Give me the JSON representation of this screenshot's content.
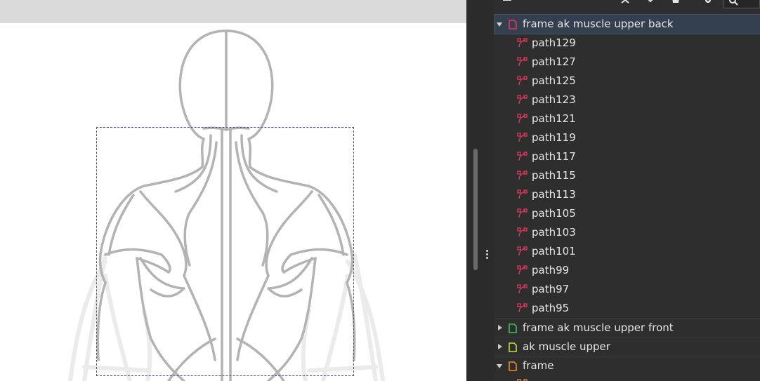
{
  "canvas": {
    "background": "#ffffff",
    "figure": "human upper back muscle diagram"
  },
  "panel": {
    "toolbar_icons": [
      "layers-icon",
      "close-icon",
      "chevron-down-icon",
      "trash-icon",
      "gear-icon",
      "search-icon"
    ],
    "tree": [
      {
        "label": "frame ak muscle upper back",
        "kind": "group",
        "expanded": true,
        "selected": true,
        "icon_color": "#e8355f",
        "icon": "group-icon"
      },
      {
        "label": "path129",
        "kind": "path",
        "icon_color": "#e8355f",
        "icon": "path-icon"
      },
      {
        "label": "path127",
        "kind": "path",
        "icon_color": "#e8355f",
        "icon": "path-icon"
      },
      {
        "label": "path125",
        "kind": "path",
        "icon_color": "#e8355f",
        "icon": "path-icon"
      },
      {
        "label": "path123",
        "kind": "path",
        "icon_color": "#e8355f",
        "icon": "path-icon"
      },
      {
        "label": "path121",
        "kind": "path",
        "icon_color": "#e8355f",
        "icon": "path-icon"
      },
      {
        "label": "path119",
        "kind": "path",
        "icon_color": "#e8355f",
        "icon": "path-icon"
      },
      {
        "label": "path117",
        "kind": "path",
        "icon_color": "#e8355f",
        "icon": "path-icon"
      },
      {
        "label": "path115",
        "kind": "path",
        "icon_color": "#e8355f",
        "icon": "path-icon"
      },
      {
        "label": "path113",
        "kind": "path",
        "icon_color": "#e8355f",
        "icon": "path-icon"
      },
      {
        "label": "path105",
        "kind": "path",
        "icon_color": "#e8355f",
        "icon": "path-icon"
      },
      {
        "label": "path103",
        "kind": "path",
        "icon_color": "#e8355f",
        "icon": "path-icon"
      },
      {
        "label": "path101",
        "kind": "path",
        "icon_color": "#e8355f",
        "icon": "path-icon"
      },
      {
        "label": "path99",
        "kind": "path",
        "icon_color": "#e8355f",
        "icon": "path-icon"
      },
      {
        "label": "path97",
        "kind": "path",
        "icon_color": "#e8355f",
        "icon": "path-icon"
      },
      {
        "label": "path95",
        "kind": "path",
        "icon_color": "#e8355f",
        "icon": "path-icon"
      },
      {
        "label": "frame ak muscle upper front",
        "kind": "group",
        "expanded": false,
        "icon_color": "#3fc15a",
        "icon": "group-icon"
      },
      {
        "label": "ak muscle upper",
        "kind": "group",
        "expanded": false,
        "icon_color": "#c6dc3a",
        "icon": "group-icon"
      },
      {
        "label": "frame",
        "kind": "group",
        "expanded": true,
        "icon_color": "#f08a2c",
        "icon": "group-icon"
      }
    ]
  },
  "colors": {
    "panel_bg": "#2e2e2e",
    "selected_row": "#34404f",
    "text": "#e6e6e6",
    "outline": "#b3b3b3",
    "faded_outline": "#e8e8e8"
  }
}
